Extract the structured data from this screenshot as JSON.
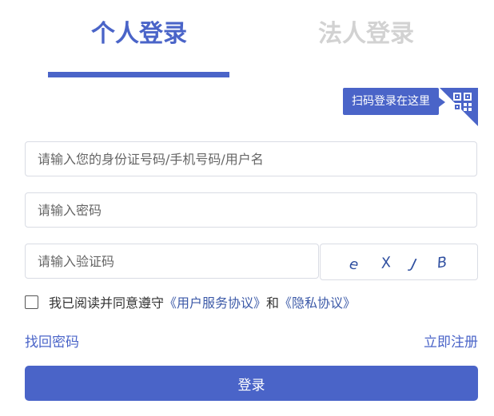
{
  "tabs": {
    "personal": "个人登录",
    "legal": "法人登录"
  },
  "qr": {
    "tip": "扫码登录在这里",
    "icon": "qr-code-icon"
  },
  "fields": {
    "username_placeholder": "请输入您的身份证号码/手机号码/用户名",
    "password_placeholder": "请输入密码",
    "captcha_placeholder": "请输入验证码"
  },
  "captcha": {
    "chars": [
      "e",
      "X",
      "J",
      "B"
    ]
  },
  "agreement": {
    "prefix": "我已阅读并同意遵守",
    "user_agreement": "《用户服务协议》",
    "and": "和",
    "privacy": "《隐私协议》"
  },
  "links": {
    "find_password": "找回密码",
    "register": "立即注册"
  },
  "login_button": "登录",
  "colors": {
    "accent": "#4a64c8",
    "inactive_tab": "#d2d2d2",
    "link": "#3c5aa8"
  }
}
